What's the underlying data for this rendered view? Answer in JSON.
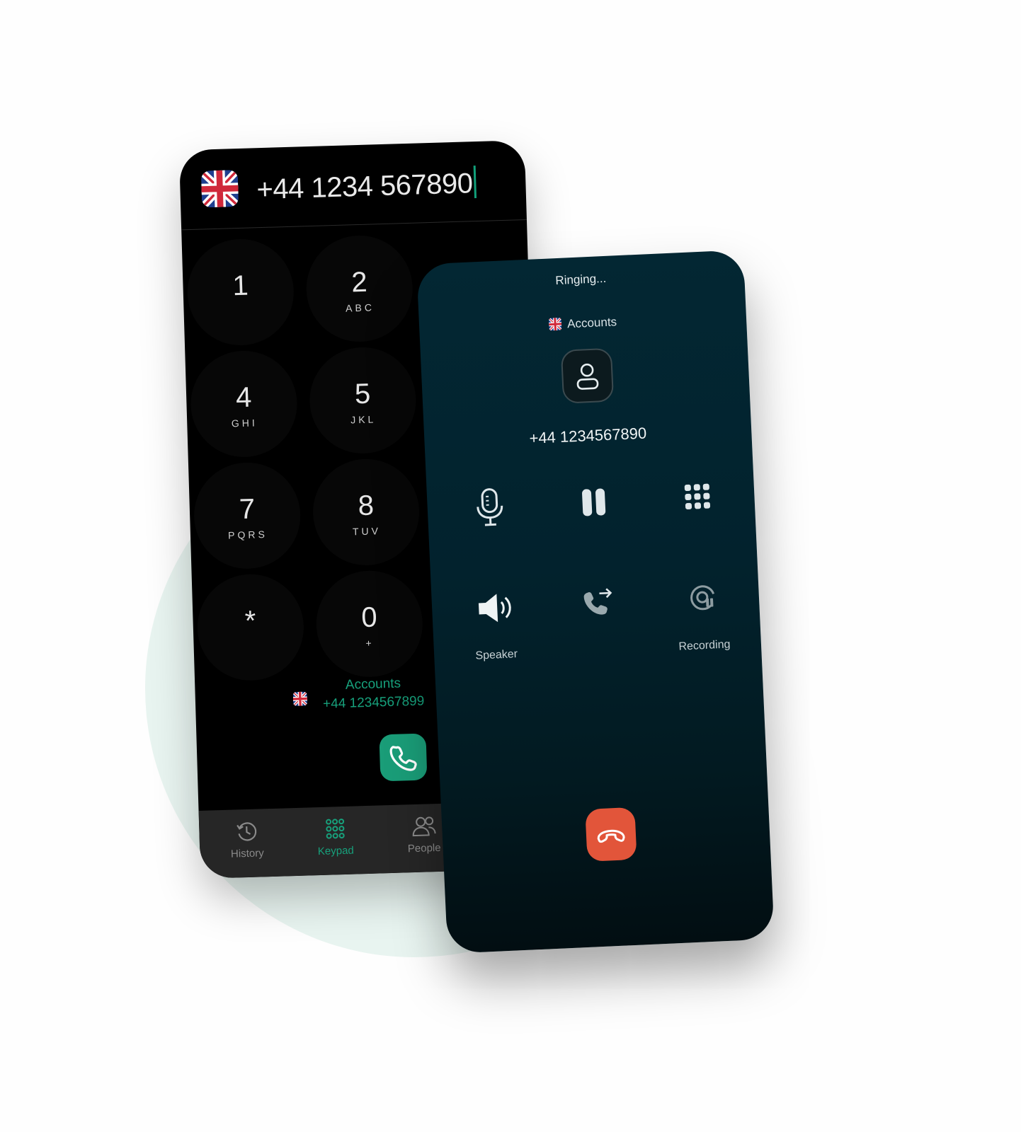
{
  "dialer": {
    "number": "+44 1234 567890",
    "keys": [
      {
        "digit": "1",
        "letters": ""
      },
      {
        "digit": "2",
        "letters": "ABC"
      },
      {
        "digit": "4",
        "letters": "GHI"
      },
      {
        "digit": "5",
        "letters": "JKL"
      },
      {
        "digit": "7",
        "letters": "PQRS"
      },
      {
        "digit": "8",
        "letters": "TUV"
      },
      {
        "digit": "*",
        "letters": ""
      },
      {
        "digit": "0",
        "letters": "+"
      }
    ],
    "account_name": "Accounts",
    "account_number": "+44 1234567899",
    "tabs": [
      {
        "label": "History",
        "icon": "history-icon"
      },
      {
        "label": "Keypad",
        "icon": "keypad-icon",
        "active": true
      },
      {
        "label": "People",
        "icon": "people-icon"
      }
    ],
    "accent_color": "#17a17c"
  },
  "call": {
    "status": "Ringing...",
    "account_name": "Accounts",
    "number": "+44 1234567890",
    "controls": [
      {
        "icon": "microphone-icon",
        "label": ""
      },
      {
        "icon": "pause-icon",
        "label": ""
      },
      {
        "icon": "keypad-icon",
        "label": ""
      },
      {
        "icon": "speaker-icon",
        "label": "Speaker"
      },
      {
        "icon": "transfer-call-icon",
        "label": ""
      },
      {
        "icon": "recording-icon",
        "label": "Recording"
      }
    ],
    "end_call_color": "#e2553a"
  }
}
